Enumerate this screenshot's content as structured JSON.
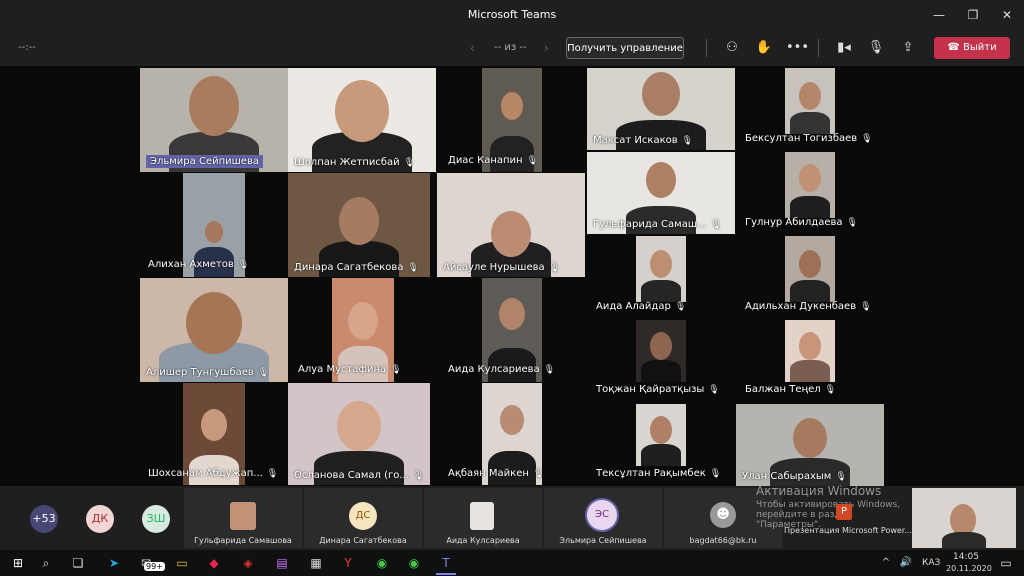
{
  "app_title": "Microsoft Teams",
  "toolbar": {
    "timer": "--:--",
    "page_indicator": "-- из --",
    "take_control": "Получить управление",
    "leave": "Выйти"
  },
  "participants": [
    {
      "name": "Эльмира Сейпишева",
      "highlighted": true
    },
    {
      "name": "Шолпан Жетписбай"
    },
    {
      "name": "Диас Канапин"
    },
    {
      "name": "Максат Искаков"
    },
    {
      "name": "Бексултан Тогизбаев"
    },
    {
      "name": "Гульфарида Самаш..."
    },
    {
      "name": "Гулнур Абилдаева"
    },
    {
      "name": "Алихан Ахметов"
    },
    {
      "name": "Динара Сагатбекова"
    },
    {
      "name": "Айсауле Нурышева"
    },
    {
      "name": "Аида Алайдар"
    },
    {
      "name": "Адильхан Дукенбаев"
    },
    {
      "name": "Алишер Тунгушбаев"
    },
    {
      "name": "Алуа Мустафина"
    },
    {
      "name": "Аида Кулсариева"
    },
    {
      "name": "Тоқжан Қайратқызы"
    },
    {
      "name": "Балжан Теңел"
    },
    {
      "name": "Шохсанам Абдужап..."
    },
    {
      "name": "Осланова Самал (го..."
    },
    {
      "name": "Ақбаян Майкен"
    },
    {
      "name": "Тексұлтан Рақымбек"
    },
    {
      "name": "Улан Сабырахым"
    }
  ],
  "tray": {
    "more_count": "+53",
    "initials": [
      "ДК",
      "ЗШ"
    ],
    "tiles": [
      {
        "label": "Гульфарида Самашова"
      },
      {
        "label": "Динара Сагатбекова",
        "initials": "ДС"
      },
      {
        "label": "Аида Кулсариева"
      },
      {
        "label": "Эльмира Сейпишева",
        "initials": "ЭС"
      },
      {
        "label": "bagdat66@bk.ru"
      }
    ],
    "presentation": "Презентация Microsoft Power...",
    "watermark_title": "Активация Windows",
    "watermark_text": "Чтобы активировать Windows, перейдите в раздел \"Параметры\"."
  },
  "taskbar": {
    "badge": "99+",
    "lang": "КАЗ",
    "time": "14:05",
    "date": "20.11.2020"
  }
}
